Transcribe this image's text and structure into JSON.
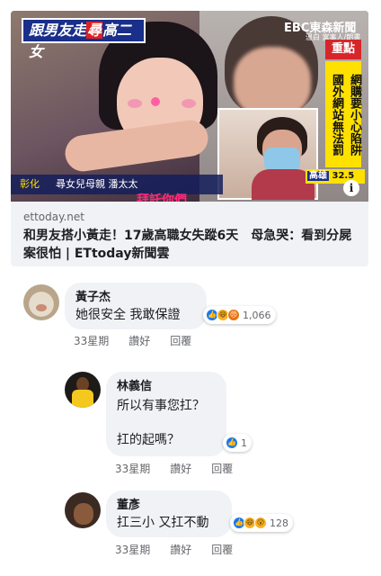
{
  "link_preview": {
    "image": {
      "headline_pre": "跟男友走",
      "headline_hl": "尋",
      "headline_post": "高二女",
      "logo": "EBC東森新聞",
      "logo_sub": "溫白 富事人/朗書",
      "red_tag": "重點",
      "vertical_1": "網購要小心陷阱",
      "vertical_2": "國外網站無法罰",
      "name_strip_location": "彰化",
      "name_strip_text": "尋女兒母親 潘太太",
      "subtitle": "拜託你們",
      "weather_city": "高雄",
      "weather_temp": "32.5"
    },
    "domain": "ettoday.net",
    "title": "和男友搭小黃走！17歲高職女失蹤6天　母急哭：看到分屍案很怕 | ETtoday新聞雲"
  },
  "comments": [
    {
      "name": "黃子杰",
      "text": "她很安全 我敢保證",
      "reaction_count": "1,066",
      "reactions": [
        "like-icon",
        "haha-icon",
        "angry-icon"
      ],
      "time": "33星期",
      "like_label": "讚好",
      "reply_label": "回覆"
    },
    {
      "name": "林義信",
      "text_line1": "所以有事您扛？",
      "text_line2": "扛的起嗎？",
      "reaction_count": "1",
      "reactions": [
        "like-icon"
      ],
      "time": "33星期",
      "like_label": "讚好",
      "reply_label": "回覆"
    },
    {
      "name": "董彥",
      "text": "扛三小 又扛不動",
      "reaction_count": "128",
      "reactions": [
        "like-icon",
        "haha-icon",
        "wow-icon"
      ],
      "time": "33星期",
      "like_label": "讚好",
      "reply_label": "回覆"
    }
  ]
}
